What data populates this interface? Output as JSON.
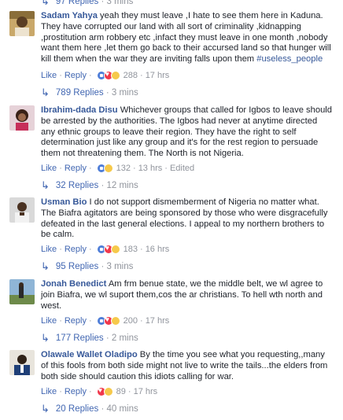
{
  "top_replies": {
    "count_label": "97 Replies",
    "time": "3 mins"
  },
  "comments": [
    {
      "author": "Sadam Yahya",
      "body": "yeah they must leave ,I hate to see them here in Kaduna. They have corrupted our land with all sort of criminality ,kidnapping ,prostitution arm robbery etc ,infact they must leave in one month ,nobody want them here ,let them go back to their accursed land so that hunger will kill them when the war they are inviting falls upon them ",
      "hashtag": "#useless_people",
      "like_label": "Like",
      "reply_label": "Reply",
      "reaction_count": "288",
      "time": "17 hrs",
      "edited": "",
      "replies_label": "789 Replies",
      "replies_time": "3 mins",
      "reactions": [
        "like",
        "love",
        "haha"
      ]
    },
    {
      "author": "Ibrahim-dada Disu",
      "body": "Whichever groups that called for Igbos to leave should be arrested by the authorities. The Igbos had never at anytime directed any ethnic groups to leave their region. They have the right to self determination just like any group and it's for the rest region to persuade them not threatening them. The North is not Nigeria.",
      "hashtag": "",
      "like_label": "Like",
      "reply_label": "Reply",
      "reaction_count": "132",
      "time": "13 hrs",
      "edited": "Edited",
      "replies_label": "32 Replies",
      "replies_time": "12 mins",
      "reactions": [
        "like",
        "haha"
      ]
    },
    {
      "author": "Usman Bio",
      "body": "I do not support dismemberment of Nigeria no matter what. The Biafra agitators are being sponsored by those who were disgracefully defeated in the last general elections. I appeal to my northern brothers to be calm.",
      "hashtag": "",
      "like_label": "Like",
      "reply_label": "Reply",
      "reaction_count": "183",
      "time": "16 hrs",
      "edited": "",
      "replies_label": "95 Replies",
      "replies_time": "3 mins",
      "reactions": [
        "like",
        "love",
        "haha"
      ]
    },
    {
      "author": "Jonah Benedict",
      "body": "Am frm benue state, we the middle belt, we wl agree to join Biafra, we wl suport them,cos the ar christians. To hell wth north and west.",
      "hashtag": "",
      "like_label": "Like",
      "reply_label": "Reply",
      "reaction_count": "200",
      "time": "17 hrs",
      "edited": "",
      "replies_label": "177 Replies",
      "replies_time": "2 mins",
      "reactions": [
        "like",
        "love",
        "haha"
      ]
    },
    {
      "author": "Olawale Wallet Oladipo",
      "body": "By the time you see what you requesting,,many of this fools from both side might not live to write the tails...the elders from both side should caution this idiots calling for war.",
      "hashtag": "",
      "like_label": "Like",
      "reply_label": "Reply",
      "reaction_count": "89",
      "time": "17 hrs",
      "edited": "",
      "replies_label": "20 Replies",
      "replies_time": "40 mins",
      "reactions": [
        "love",
        "haha"
      ]
    }
  ],
  "colors": {
    "link": "#365899",
    "meta": "#90949c",
    "action": "#4267b2"
  }
}
